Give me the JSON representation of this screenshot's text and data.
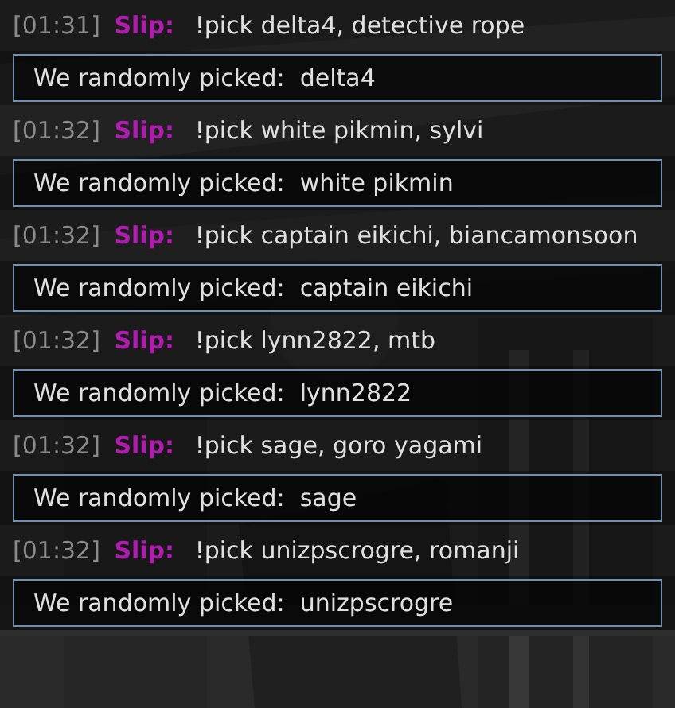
{
  "entries": [
    {
      "kind": "message",
      "time": "[01:31]",
      "user": "Slip:",
      "text": "!pick delta4, detective rope"
    },
    {
      "kind": "bot",
      "text": "We randomly picked:  delta4"
    },
    {
      "kind": "message",
      "time": "[01:32]",
      "user": "Slip:",
      "text": "!pick white pikmin, sylvi"
    },
    {
      "kind": "bot",
      "text": "We randomly picked:  white pikmin"
    },
    {
      "kind": "message",
      "time": "[01:32]",
      "user": "Slip:",
      "text": "!pick captain eikichi, biancamonsoon"
    },
    {
      "kind": "bot",
      "text": "We randomly picked:  captain eikichi"
    },
    {
      "kind": "message",
      "time": "[01:32]",
      "user": "Slip:",
      "text": "!pick lynn2822, mtb"
    },
    {
      "kind": "bot",
      "text": "We randomly picked:  lynn2822"
    },
    {
      "kind": "message",
      "time": "[01:32]",
      "user": "Slip:",
      "text": "!pick sage, goro yagami"
    },
    {
      "kind": "bot",
      "text": "We randomly picked:  sage"
    },
    {
      "kind": "message",
      "time": "[01:32]",
      "user": "Slip:",
      "text": "!pick unizpscrogre, romanji"
    },
    {
      "kind": "bot",
      "text": "We randomly picked:  unizpscrogre"
    }
  ]
}
